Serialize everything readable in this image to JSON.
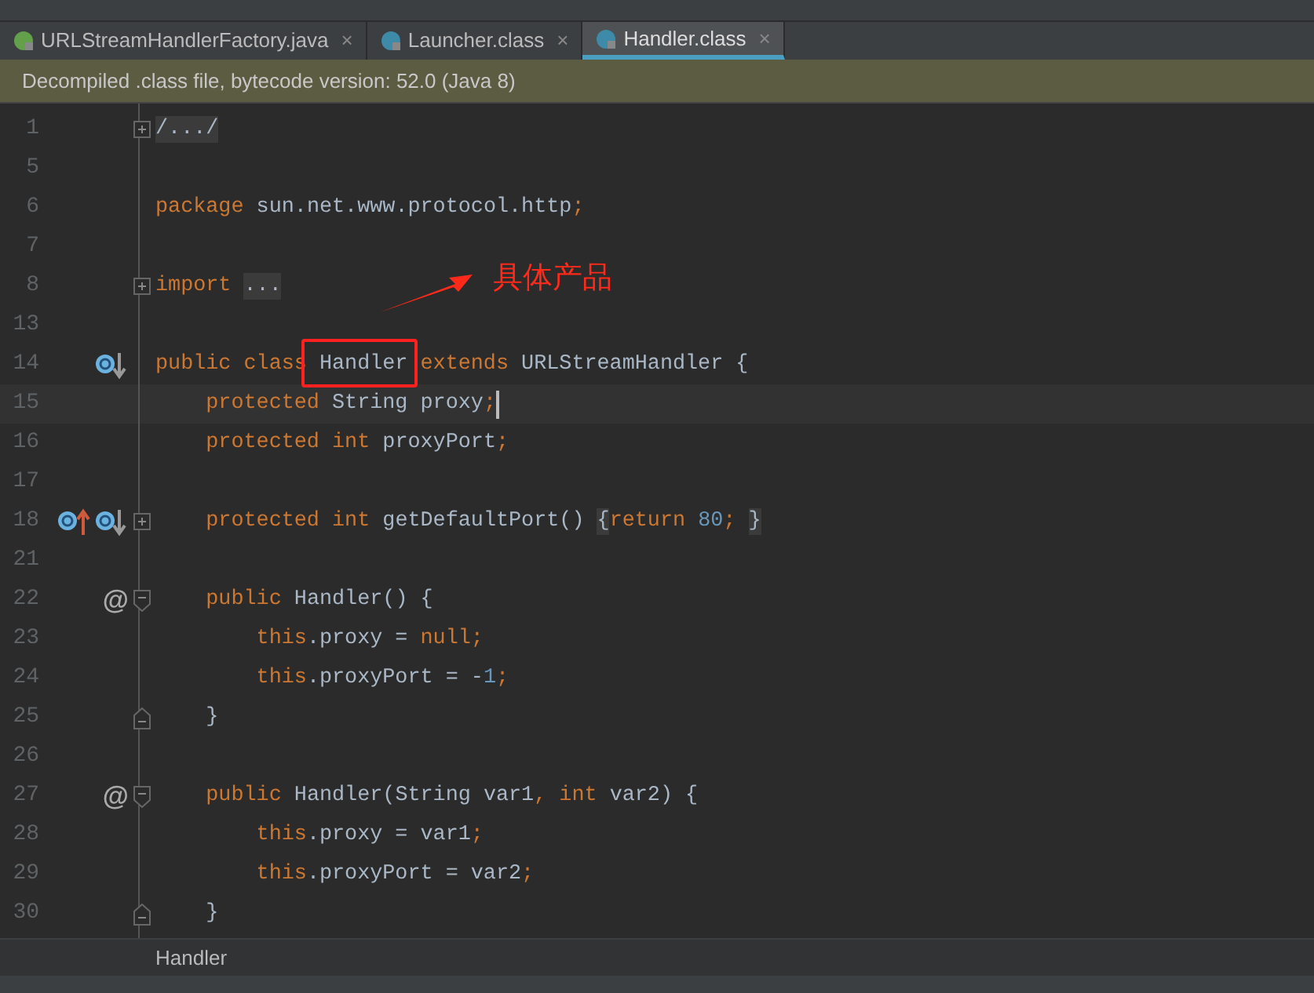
{
  "tabs": [
    {
      "label": "URLStreamHandlerFactory.java",
      "kind": "interface",
      "close": "×",
      "selected": false
    },
    {
      "label": "Launcher.class",
      "kind": "class",
      "close": "×",
      "selected": false
    },
    {
      "label": "Handler.class",
      "kind": "class",
      "close": "×",
      "selected": true
    }
  ],
  "banner": "Decompiled .class file, bytecode version: 52.0 (Java 8)",
  "lines": [
    {
      "number": "1",
      "fold": {
        "kind": "plus"
      },
      "tokens": [
        {
          "kind": "folded",
          "text": "/.../"
        }
      ]
    },
    {
      "number": "5"
    },
    {
      "number": "6",
      "tokens": [
        {
          "kind": "kw",
          "text": "package "
        },
        {
          "kind": "id",
          "text": "sun.net.www.protocol.http"
        },
        {
          "kind": "kw",
          "text": ";"
        }
      ]
    },
    {
      "number": "7"
    },
    {
      "number": "8",
      "fold": {
        "kind": "plus"
      },
      "tokens": [
        {
          "kind": "kw",
          "text": "import "
        },
        {
          "kind": "folded",
          "text": "..."
        }
      ]
    },
    {
      "number": "13"
    },
    {
      "number": "14",
      "marks": [
        {
          "kind": "implemented"
        }
      ],
      "tokens": [
        {
          "kind": "kw",
          "text": "public class "
        },
        {
          "kind": "id",
          "text": "Handler"
        },
        {
          "kind": "kw",
          "text": " extends "
        },
        {
          "kind": "id",
          "text": "URLStreamHandler {"
        }
      ]
    },
    {
      "number": "15",
      "current": true,
      "tokens": [
        {
          "kind": "kw",
          "text": "    protected "
        },
        {
          "kind": "id",
          "text": "String proxy"
        },
        {
          "kind": "kw",
          "text": ";"
        }
      ]
    },
    {
      "number": "16",
      "tokens": [
        {
          "kind": "kw",
          "text": "    protected int "
        },
        {
          "kind": "id",
          "text": "proxyPort"
        },
        {
          "kind": "kw",
          "text": ";"
        }
      ]
    },
    {
      "number": "17"
    },
    {
      "number": "18",
      "marks": [
        {
          "kind": "overrides"
        },
        {
          "kind": "implemented"
        }
      ],
      "fold": {
        "kind": "plus"
      },
      "tokens": [
        {
          "kind": "kw",
          "text": "    protected int "
        },
        {
          "kind": "id",
          "text": "getDefaultPort() "
        },
        {
          "kind": "folded",
          "text": "{"
        },
        {
          "kind": "kw",
          "text": "return "
        },
        {
          "kind": "num",
          "text": "80"
        },
        {
          "kind": "kw",
          "text": "; "
        },
        {
          "kind": "folded",
          "text": "}"
        }
      ]
    },
    {
      "number": "21"
    },
    {
      "number": "22",
      "marks": [
        {
          "kind": "annotation",
          "text": "@"
        }
      ],
      "fold": {
        "kind": "open"
      },
      "tokens": [
        {
          "kind": "kw",
          "text": "    public "
        },
        {
          "kind": "id",
          "text": "Handler() {"
        }
      ]
    },
    {
      "number": "23",
      "tokens": [
        {
          "kind": "kw",
          "text": "        this"
        },
        {
          "kind": "id",
          "text": ".proxy = "
        },
        {
          "kind": "kw",
          "text": "null;"
        }
      ]
    },
    {
      "number": "24",
      "tokens": [
        {
          "kind": "kw",
          "text": "        this"
        },
        {
          "kind": "id",
          "text": ".proxyPort = -"
        },
        {
          "kind": "num",
          "text": "1"
        },
        {
          "kind": "kw",
          "text": ";"
        }
      ]
    },
    {
      "number": "25",
      "fold": {
        "kind": "close"
      },
      "tokens": [
        {
          "kind": "id",
          "text": "    }"
        }
      ]
    },
    {
      "number": "26"
    },
    {
      "number": "27",
      "marks": [
        {
          "kind": "annotation",
          "text": "@"
        }
      ],
      "fold": {
        "kind": "open"
      },
      "tokens": [
        {
          "kind": "kw",
          "text": "    public "
        },
        {
          "kind": "id",
          "text": "Handler(String var1"
        },
        {
          "kind": "kw",
          "text": ", int "
        },
        {
          "kind": "id",
          "text": "var2) {"
        }
      ]
    },
    {
      "number": "28",
      "tokens": [
        {
          "kind": "kw",
          "text": "        this"
        },
        {
          "kind": "id",
          "text": ".proxy = var1"
        },
        {
          "kind": "kw",
          "text": ";"
        }
      ]
    },
    {
      "number": "29",
      "tokens": [
        {
          "kind": "kw",
          "text": "        this"
        },
        {
          "kind": "id",
          "text": ".proxyPort = var2"
        },
        {
          "kind": "kw",
          "text": ";"
        }
      ]
    },
    {
      "number": "30",
      "fold": {
        "kind": "close"
      },
      "tokens": [
        {
          "kind": "id",
          "text": "    }"
        }
      ]
    }
  ],
  "callout": {
    "label": "具体产品"
  },
  "breadcrumb": "Handler"
}
